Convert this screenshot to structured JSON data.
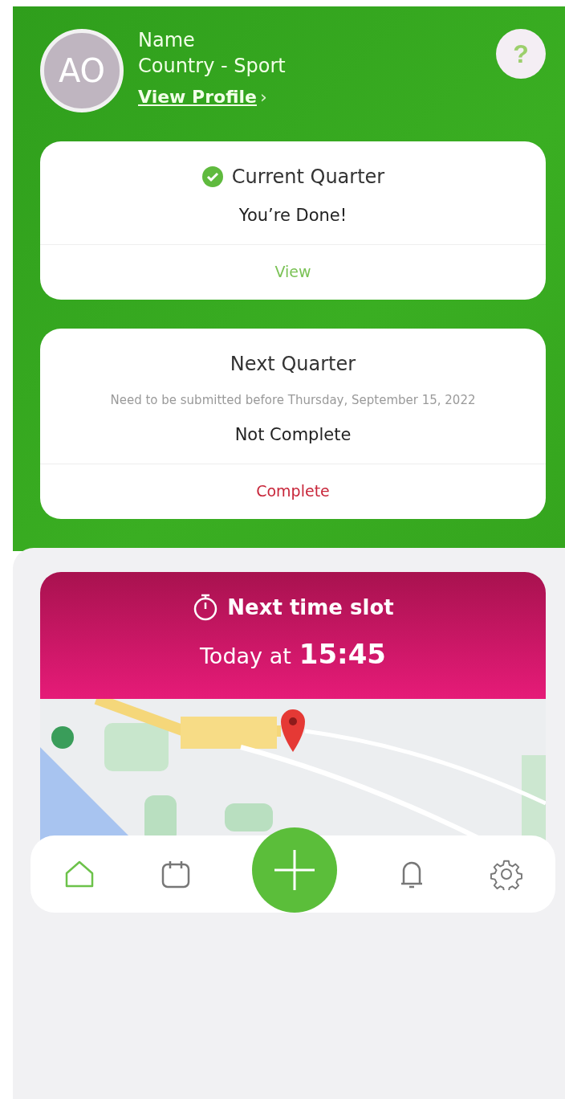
{
  "profile": {
    "initials": "AO",
    "name": "Name",
    "subtitle": "Country - Sport",
    "link": "View Profile",
    "chevron": "›",
    "help": "?"
  },
  "current_quarter": {
    "title": "Current Quarter",
    "done": true,
    "status": "You’re Done!",
    "action": "View"
  },
  "next_quarter": {
    "title": "Next Quarter",
    "note": "Need to be submitted before Thursday, September 15, 2022",
    "status": "Not Complete",
    "action": "Complete"
  },
  "time_slot": {
    "title": "Next time slot",
    "prefix": "Today at",
    "time": "15:45"
  },
  "nav": [
    {
      "kind": "home",
      "selected": true
    },
    {
      "kind": "calendar",
      "selected": false
    },
    {
      "kind": "add",
      "selected": false
    },
    {
      "kind": "bell",
      "selected": false
    },
    {
      "kind": "settings",
      "selected": false
    }
  ]
}
